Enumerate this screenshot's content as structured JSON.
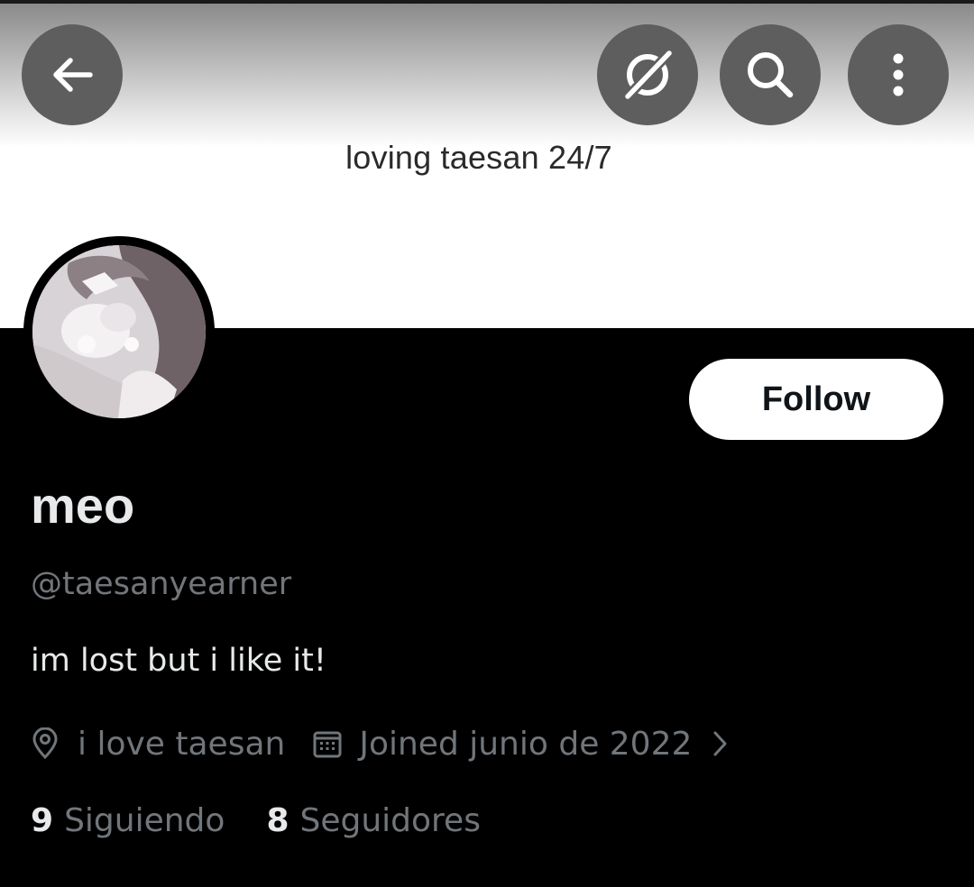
{
  "header": {
    "back_icon": "arrow-left-icon",
    "grok_icon": "grok-icon",
    "search_icon": "search-icon",
    "more_icon": "more-vertical-icon",
    "button_color": "#5e5e5e"
  },
  "banner": {
    "text": "loving taesan 24/7"
  },
  "profile": {
    "avatar_alt": "profile photo",
    "display_name": "meo",
    "handle": "@taesanyearner",
    "bio": "im lost but i like it!",
    "location": "i love taesan",
    "joined": "Joined junio de 2022",
    "following_count": "9",
    "following_label": "Siguiendo",
    "followers_count": "8",
    "followers_label": "Seguidores"
  },
  "actions": {
    "follow_label": "Follow"
  },
  "colors": {
    "background": "#000000",
    "primary_text": "#e7e9ea",
    "secondary_text": "#71767b",
    "follow_bg": "#ffffff"
  }
}
